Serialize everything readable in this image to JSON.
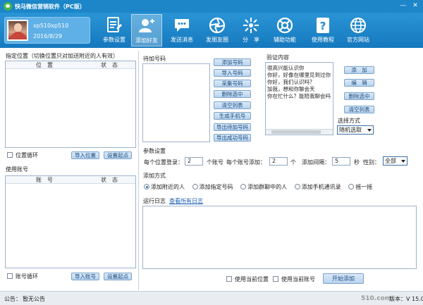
{
  "window": {
    "title": "快马微信营销软件（PC版）"
  },
  "profile": {
    "username": "xp510xp510",
    "date": "2016/8/29"
  },
  "toolbar": {
    "items": [
      {
        "label": "参数设置",
        "icon": "document-icon"
      },
      {
        "label": "添加好友",
        "icon": "add-user-icon"
      },
      {
        "label": "发送消息",
        "icon": "chat-bubble-icon"
      },
      {
        "label": "发朋友圈",
        "icon": "camera-aperture-icon"
      },
      {
        "label": "分　享",
        "icon": "share-star-icon"
      },
      {
        "label": "辅助功能",
        "icon": "lifebuoy-icon"
      },
      {
        "label": "使用教程",
        "icon": "help-icon"
      },
      {
        "label": "官方网站",
        "icon": "globe-icon"
      }
    ],
    "active": "添加好友"
  },
  "location_panel": {
    "label": "指定位置（切换位置只对加送附近的人有效）",
    "columns": [
      "位　置",
      "状　态"
    ],
    "loop_label": "位置循环",
    "import_button": "导入位置",
    "start_button": "设置起点"
  },
  "account_panel": {
    "label": "使用账号",
    "columns": [
      "账　号",
      "状　态"
    ],
    "loop_label": "账号循环",
    "import_button": "导入账号",
    "start_button": "设置起点"
  },
  "pending_panel": {
    "label": "待加号码",
    "buttons": [
      "添加号码",
      "导入号码",
      "采集号码",
      "删除选中",
      "清空列表",
      "生成手机号",
      "导出待加号码",
      "导出成功号码"
    ]
  },
  "verify_panel": {
    "label": "验证内容",
    "lines": [
      "很高兴能认识你",
      "你好，好像在哪里见到过你",
      "你好，我们认识吗？",
      "加我，想和你聊会天",
      "你在忙什么？能陪我聊会吗"
    ],
    "buttons": [
      "添　加",
      "编　辑",
      "删除选中",
      "清空列表"
    ],
    "select_label": "选择方式",
    "select_value": "随机选取"
  },
  "params": {
    "label": "参数设置",
    "per_location_label": "每个位置登录：",
    "per_location_value": "2",
    "per_location_unit": "个账号",
    "per_account_label": "每个账号添加：",
    "per_account_value": "2",
    "per_account_unit": "个",
    "interval_label": "添加间隔：",
    "interval_value": "5",
    "interval_unit": "秒",
    "gender_label": "性别：",
    "gender_value": "全部"
  },
  "add_mode": {
    "label": "添加方式",
    "options": [
      "添加附近的人",
      "添加指定号码",
      "添加群聊中的人",
      "添加手机通讯录",
      "摇一摇"
    ],
    "selected": 0
  },
  "log": {
    "label": "运行日志",
    "link": "查看所有日志"
  },
  "bottom": {
    "use_location": "使用当前位置",
    "use_account": "使用当前账号",
    "start_button": "开始添加"
  },
  "status": {
    "notice_label": "公告：",
    "notice_text": "暂无公告",
    "version": "版本：V 15.0"
  },
  "watermark": "510.com",
  "colors": {
    "titlebar": "#1c86c9",
    "toolbar": "#1e88cc",
    "button_text": "#1a4d80",
    "link": "#1b5fb6"
  }
}
